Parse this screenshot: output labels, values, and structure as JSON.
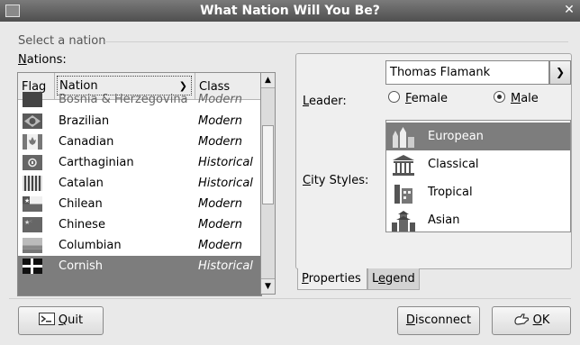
{
  "window": {
    "title": "What Nation Will You Be?"
  },
  "group": {
    "label": "Select a nation"
  },
  "nations_label": {
    "mnemonic": "N",
    "rest": "ations:"
  },
  "table": {
    "headers": {
      "flag": "Flag",
      "nation": "Nation",
      "class": "Class"
    },
    "rows": [
      {
        "nation": "Bosnia & Herzegovina",
        "class": "Modern",
        "flag_icon": "bosnian-flag-icon"
      },
      {
        "nation": "Brazilian",
        "class": "Modern",
        "flag_icon": "brazilian-flag-icon"
      },
      {
        "nation": "Canadian",
        "class": "Modern",
        "flag_icon": "canadian-flag-icon"
      },
      {
        "nation": "Carthaginian",
        "class": "Historical",
        "flag_icon": "carthaginian-flag-icon"
      },
      {
        "nation": "Catalan",
        "class": "Historical",
        "flag_icon": "catalan-flag-icon"
      },
      {
        "nation": "Chilean",
        "class": "Modern",
        "flag_icon": "chilean-flag-icon"
      },
      {
        "nation": "Chinese",
        "class": "Modern",
        "flag_icon": "chinese-flag-icon"
      },
      {
        "nation": "Columbian",
        "class": "Modern",
        "flag_icon": "columbian-flag-icon"
      },
      {
        "nation": "Cornish",
        "class": "Historical",
        "flag_icon": "cornish-flag-icon",
        "selected": true
      }
    ]
  },
  "properties": {
    "leader_label": {
      "mnemonic": "L",
      "rest": "eader:"
    },
    "leader_value": "Thomas Flamank",
    "gender": {
      "female": {
        "mnemonic": "F",
        "rest": "emale",
        "selected": false
      },
      "male": {
        "mnemonic": "M",
        "rest": "ale",
        "selected": true
      }
    },
    "city_styles_label": {
      "mnemonic": "C",
      "rest": "ity Styles:"
    },
    "city_styles": [
      {
        "label": "European",
        "icon": "european-city-icon",
        "selected": true
      },
      {
        "label": "Classical",
        "icon": "classical-city-icon"
      },
      {
        "label": "Tropical",
        "icon": "tropical-city-icon"
      },
      {
        "label": "Asian",
        "icon": "asian-city-icon"
      }
    ]
  },
  "tabs": {
    "properties": {
      "mnemonic": "P",
      "rest": "roperties"
    },
    "legend": {
      "pre": "L",
      "mnemonic": "e",
      "rest": "gend"
    }
  },
  "buttons": {
    "quit": {
      "mnemonic": "Q",
      "rest": "uit",
      "icon": "quit-icon"
    },
    "disconnect": {
      "mnemonic": "D",
      "rest": "isconnect"
    },
    "ok": {
      "mnemonic": "O",
      "rest": "K",
      "icon": "ok-hand-icon"
    }
  },
  "colors": {
    "selection": "#7d7d7d",
    "titlebar": "#5a5a5a"
  }
}
